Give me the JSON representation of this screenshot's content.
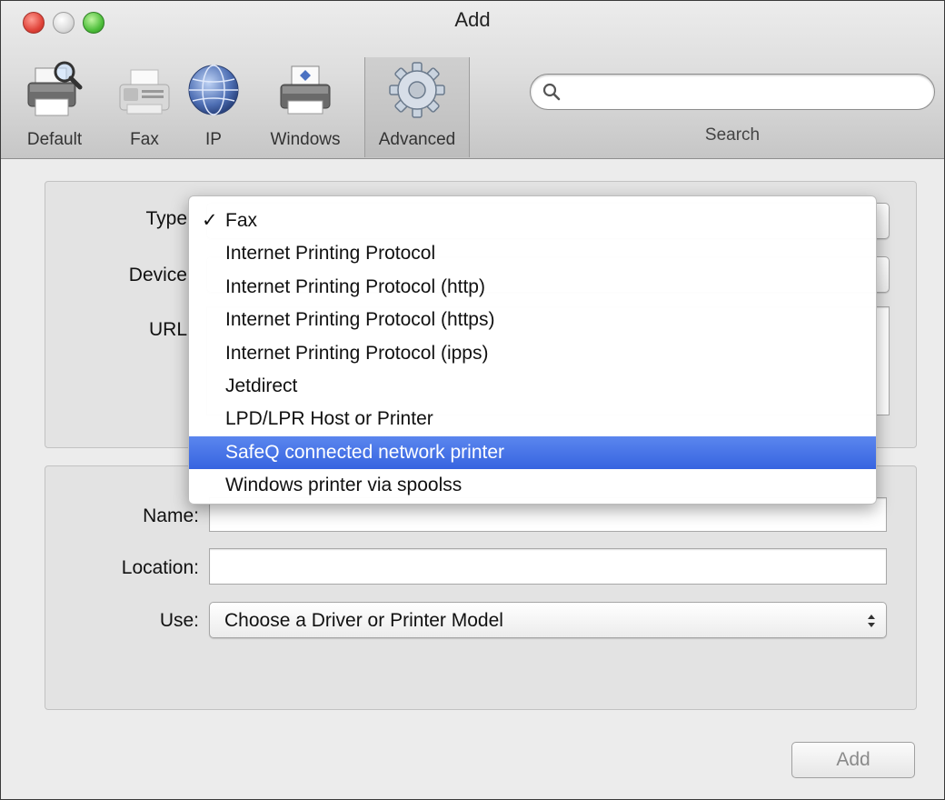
{
  "window": {
    "title": "Add"
  },
  "toolbar": {
    "items": [
      {
        "label": "Default",
        "icon": "printer-magnifier-icon"
      },
      {
        "label": "Fax",
        "icon": "fax-icon"
      },
      {
        "label": "IP",
        "icon": "globe-icon"
      },
      {
        "label": "Windows",
        "icon": "windows-printer-icon"
      },
      {
        "label": "Advanced",
        "icon": "gear-icon"
      }
    ],
    "selected": "Advanced",
    "search": {
      "label": "Search",
      "value": ""
    }
  },
  "form": {
    "type_label": "Type",
    "device_label": "Device",
    "url_label": "URL",
    "name_label": "Name:",
    "location_label": "Location:",
    "use_label": "Use:",
    "use_value": "Choose a Driver or Printer Model",
    "name_value": "",
    "location_value": ""
  },
  "type_menu": {
    "checkmark": "✓",
    "checked": "Fax",
    "highlighted": "SafeQ connected network printer",
    "items": [
      "Fax",
      "Internet Printing Protocol",
      "Internet Printing Protocol (http)",
      "Internet Printing Protocol (https)",
      "Internet Printing Protocol (ipps)",
      "Jetdirect",
      "LPD/LPR Host or Printer",
      "SafeQ connected network printer",
      "Windows printer via spoolss"
    ]
  },
  "buttons": {
    "add": "Add"
  },
  "colors": {
    "highlight": "#3d6be2",
    "close": "#e0443a",
    "zoom": "#4fbf3c"
  }
}
